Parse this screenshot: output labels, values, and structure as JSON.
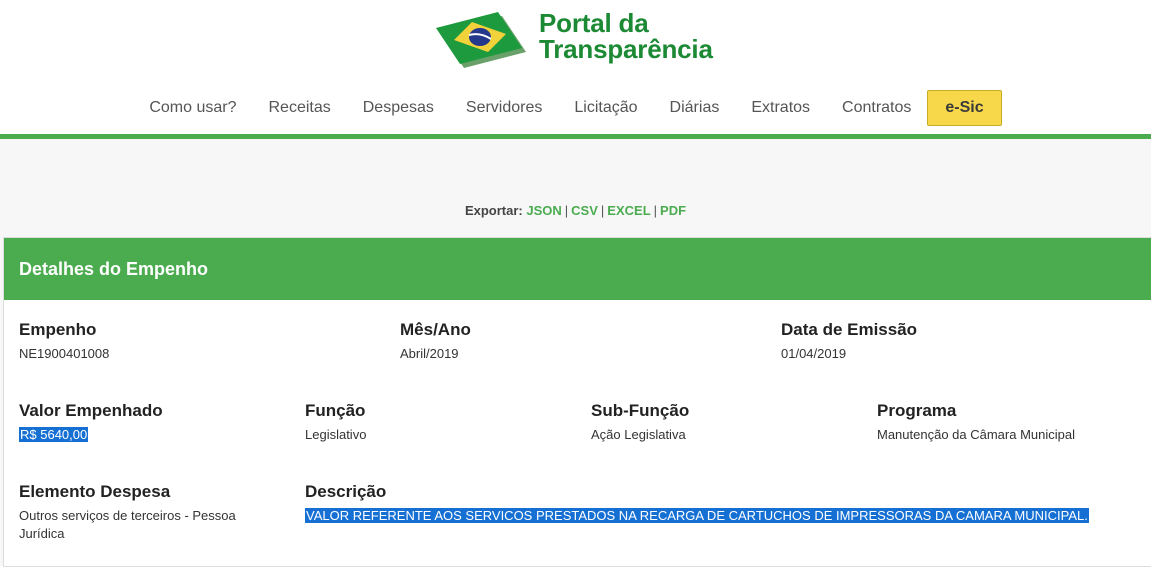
{
  "header": {
    "logo_line1": "Portal da",
    "logo_line2": "Transparência"
  },
  "nav": {
    "items": [
      "Como usar?",
      "Receitas",
      "Despesas",
      "Servidores",
      "Licitação",
      "Diárias",
      "Extratos",
      "Contratos"
    ],
    "esic_label": "e-Sic"
  },
  "export": {
    "label": "Exportar:",
    "json": "JSON",
    "csv": "CSV",
    "excel": "EXCEL",
    "pdf": "PDF",
    "separator": "|"
  },
  "card": {
    "title": "Detalhes do Empenho",
    "empenho": {
      "label": "Empenho",
      "value": "NE1900401008"
    },
    "mes_ano": {
      "label": "Mês/Ano",
      "value": "Abril/2019"
    },
    "data_emissao": {
      "label": "Data de Emissão",
      "value": "01/04/2019"
    },
    "valor_empenhado": {
      "label": "Valor Empenhado",
      "value": "R$ 5640,00"
    },
    "funcao": {
      "label": "Função",
      "value": "Legislativo"
    },
    "sub_funcao": {
      "label": "Sub-Função",
      "value": "Ação Legislativa"
    },
    "programa": {
      "label": "Programa",
      "value": "Manutenção da Câmara Municipal"
    },
    "elemento_despesa": {
      "label": "Elemento Despesa",
      "value": "Outros serviços de terceiros - Pessoa Jurídica"
    },
    "descricao": {
      "label": "Descrição",
      "value": "VALOR REFERENTE AOS SERVICOS PRESTADOS NA RECARGA DE CARTUCHOS DE IMPRESSORAS DA CAMARA MUNICIPAL."
    }
  },
  "colors": {
    "brand_green": "#4aab4f",
    "logo_green": "#1c8a34",
    "esic_yellow": "#f6d84a",
    "selection_blue": "#1670d4"
  }
}
